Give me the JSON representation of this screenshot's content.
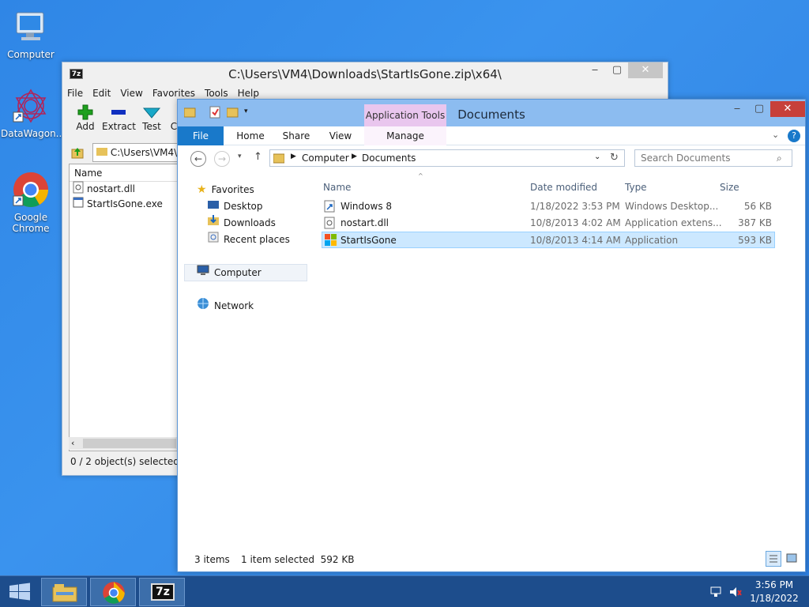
{
  "desktop": {
    "icons": [
      {
        "label": "Computer",
        "icon": "computer-icon"
      },
      {
        "label": "DataWagon...",
        "icon": "datawagon-icon"
      },
      {
        "label": "Google Chrome",
        "icon": "chrome-icon"
      }
    ]
  },
  "zip_window": {
    "title": "C:\\Users\\VM4\\Downloads\\StartIsGone.zip\\x64\\",
    "logo": "7z",
    "menu": [
      "File",
      "Edit",
      "View",
      "Favorites",
      "Tools",
      "Help"
    ],
    "toolbar": [
      {
        "label": "Add",
        "icon": "plus-icon"
      },
      {
        "label": "Extract",
        "icon": "minus-icon"
      },
      {
        "label": "Test",
        "icon": "checkmark-icon"
      },
      {
        "label": "C",
        "icon": "copy-icon"
      }
    ],
    "path": "C:\\Users\\VM4\\D",
    "list_header": "Name",
    "files": [
      "nostart.dll",
      "StartIsGone.exe"
    ],
    "status": "0 / 2 object(s) selected",
    "colors": {
      "add": "#1ea01e",
      "extract": "#1030c0",
      "test": "#18a8c8"
    }
  },
  "explorer": {
    "title": "Documents",
    "ribbon": {
      "file": "File",
      "tabs": [
        "Home",
        "Share",
        "View",
        "Manage"
      ],
      "contextual": "Application Tools"
    },
    "address": {
      "parts": [
        "Computer",
        "Documents"
      ]
    },
    "search_placeholder": "Search Documents",
    "nav": {
      "favorites": "Favorites",
      "favorite_items": [
        "Desktop",
        "Downloads",
        "Recent places"
      ],
      "computer": "Computer",
      "network": "Network"
    },
    "columns": {
      "name": "Name",
      "date": "Date modified",
      "type": "Type",
      "size": "Size"
    },
    "rows": [
      {
        "name": "Windows 8",
        "date": "1/18/2022 3:53 PM",
        "type": "Windows Desktop...",
        "size": "56 KB",
        "icon": "shortcut-icon"
      },
      {
        "name": "nostart.dll",
        "date": "10/8/2013 4:02 AM",
        "type": "Application extens...",
        "size": "387 KB",
        "icon": "dll-icon"
      },
      {
        "name": "StartIsGone",
        "date": "10/8/2013 4:14 AM",
        "type": "Application",
        "size": "593 KB",
        "icon": "app-icon"
      }
    ],
    "selected_row": 2,
    "status": {
      "items": "3 items",
      "selected": "1 item selected  592 KB"
    },
    "colors": {
      "accent": "#1979ca",
      "selection": "#cce8ff",
      "titlebar": "#8cbcf0",
      "close": "#c7403a"
    }
  },
  "taskbar": {
    "apps": [
      "file-explorer",
      "chrome",
      "7-zip"
    ],
    "zip_label": "7z",
    "time": "3:56 PM",
    "date": "1/18/2022"
  }
}
